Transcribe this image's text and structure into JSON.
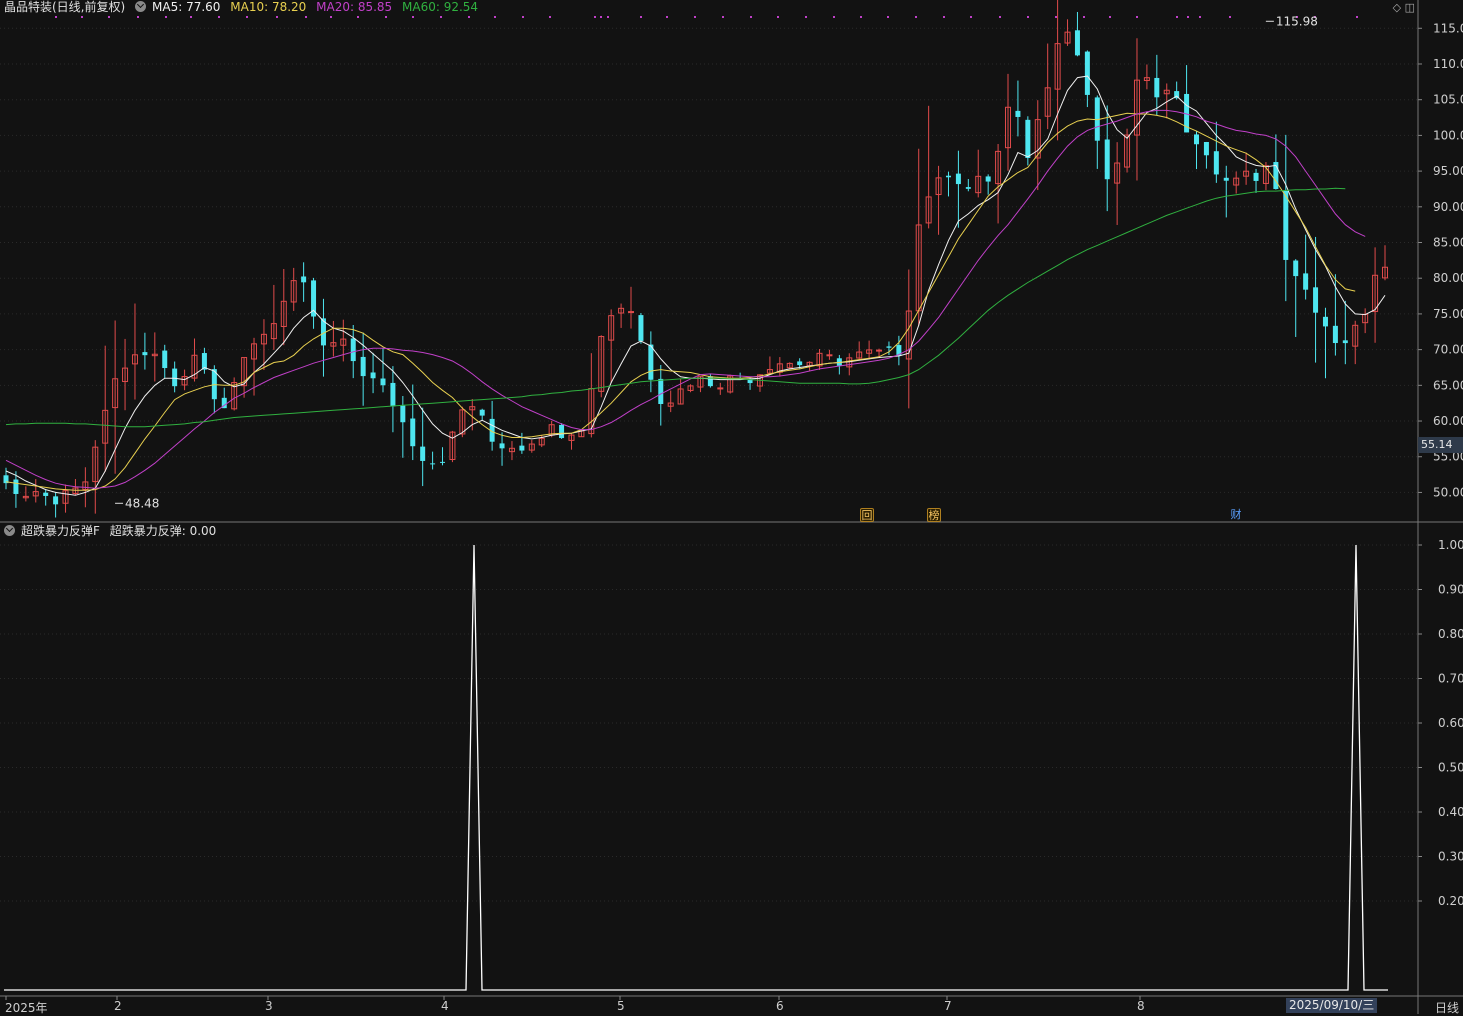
{
  "header": {
    "title": "晶品特装(日线,前复权)",
    "ma5": "MA5: 77.60",
    "ma10": "MA10: 78.20",
    "ma20": "MA20: 85.85",
    "ma60": "MA60: 92.54"
  },
  "indicator": {
    "name": "超跌暴力反弹F",
    "value_label": "超跌暴力反弹: 0.00"
  },
  "price_tag": "55.14",
  "markers": [
    {
      "label": "回",
      "style": "gold"
    },
    {
      "label": "榜",
      "style": "gold"
    },
    {
      "label": "财",
      "style": "blue"
    }
  ],
  "x_axis_labels": [
    "2025年",
    "2",
    "3",
    "4",
    "5",
    "6",
    "7",
    "8"
  ],
  "cursor_date": "2025/09/10/三",
  "period": "日线",
  "colors": {
    "background": "#121212",
    "up": "#e04b4b",
    "down": "#4ee6f0",
    "ma5": "#f0f0f0",
    "ma10": "#e8d050",
    "ma20": "#c040c8",
    "ma60": "#30b040",
    "indicator": "#ffffff"
  },
  "chart_data": [
    {
      "type": "candlestick",
      "title": "晶品特装(日线,前复权)",
      "ylim": [
        46,
        117
      ],
      "y_ticks": [
        "50.00",
        "55.00",
        "60.00",
        "65.00",
        "70.00",
        "75.00",
        "80.00",
        "85.00",
        "90.00",
        "95.00",
        "100.00",
        "105.00",
        "110.00",
        "115.00"
      ],
      "annotations": [
        "48.48",
        "115.98"
      ],
      "series": [
        {
          "name": "MA5",
          "values": [
            53,
            52.4,
            51.6,
            51,
            50.4,
            50,
            49.8,
            49.6,
            50,
            50.6,
            53,
            56,
            59,
            61.5,
            63.5,
            65,
            66,
            66,
            65.8,
            66.5,
            67.5,
            67,
            65.5,
            64.8,
            65.2,
            66.8,
            68,
            69.5,
            71,
            73,
            74.5,
            75.5,
            74,
            73,
            72.6,
            71.7,
            70.6,
            69.4,
            68.2,
            67,
            65.4,
            63.5,
            61.5,
            59.6,
            58.3,
            57.6,
            58.4,
            59.5,
            60.1,
            59.4,
            58.7,
            58.2,
            57.7,
            57.5,
            57.7,
            58,
            58.2,
            58.3,
            58.6,
            58.9,
            62,
            65.4,
            68,
            70.5,
            71.2,
            70.5,
            68.7,
            67.2,
            66.2,
            66,
            66,
            65.9,
            65.8,
            65.8,
            65.8,
            65.9,
            66,
            66.5,
            67,
            67.3,
            67.5,
            67.7,
            67.9,
            68.1,
            68.2,
            68.3,
            68.5,
            68.7,
            68.9,
            69,
            69.1,
            69.5,
            73.4,
            78.3,
            81.9,
            85.3,
            88,
            89,
            90.2,
            91,
            92,
            94.5,
            97.6,
            97,
            97.9,
            99.5,
            103,
            106.3,
            108.1,
            108.3,
            106.5,
            103.2,
            100.8,
            99.6,
            101.4,
            103.2,
            103.8,
            104.7,
            105.5,
            104.2,
            103.4,
            101.7,
            100,
            98.6,
            97,
            96.3,
            95.8,
            95.6,
            95.8,
            93.1,
            89.7,
            86.8,
            84,
            81.7,
            78.8,
            76.4,
            75,
            74.9,
            75.6,
            77.6
          ]
        },
        {
          "name": "MA10",
          "values": [
            51.5,
            51.3,
            51.1,
            50.9,
            50.7,
            50.5,
            50.4,
            50.3,
            50.3,
            50.4,
            50.9,
            51.9,
            53.5,
            55.5,
            57.5,
            59.3,
            61.2,
            63,
            63.8,
            64.3,
            64.8,
            65.1,
            65,
            65,
            65.5,
            66.8,
            67.5,
            68.2,
            68.4,
            69.2,
            70.5,
            71.5,
            72.3,
            73,
            73,
            72.8,
            72.3,
            71.3,
            70.4,
            69.7,
            69.3,
            68.1,
            66.8,
            65.4,
            64.3,
            63.3,
            61.8,
            60.6,
            59.5,
            58.5,
            58,
            57.7,
            57.7,
            57.8,
            58,
            58.2,
            58.3,
            58.3,
            58.8,
            59.9,
            61.2,
            62.5,
            64,
            65.5,
            66.4,
            67,
            67.2,
            67,
            66.9,
            66.8,
            66.5,
            66.2,
            66.1,
            66,
            66,
            66.1,
            66.3,
            66.6,
            66.9,
            67.1,
            67.3,
            67.6,
            67.9,
            68.1,
            68.2,
            68.4,
            68.6,
            68.8,
            69,
            69.7,
            71,
            73,
            75.5,
            78,
            80.5,
            83,
            85.5,
            87.5,
            89.5,
            91.5,
            92.8,
            93.8,
            94.8,
            95.5,
            97.3,
            99,
            100.3,
            101.3,
            102,
            102.3,
            102.2,
            102.5,
            102.8,
            103.1,
            103,
            103,
            102.8,
            102.5,
            101.9,
            101.2,
            100.6,
            99.9,
            99.2,
            98.5,
            98,
            97.5,
            96.6,
            95.5,
            93.6,
            91.5,
            89.3,
            87.1,
            84.4,
            81.8,
            79.8,
            78.5,
            78.2
          ]
        },
        {
          "name": "MA20",
          "values": [
            54.5,
            53.8,
            53.1,
            52.4,
            51.8,
            51.3,
            51,
            50.8,
            50.7,
            50.6,
            50.7,
            50.9,
            51.4,
            52.2,
            53.1,
            54.1,
            55.3,
            56.5,
            57.7,
            58.9,
            60,
            61.2,
            62.2,
            63.2,
            63.9,
            64.7,
            65.4,
            66.1,
            66.6,
            67.1,
            67.6,
            68.1,
            68.5,
            68.9,
            69.3,
            69.7,
            70,
            70.2,
            70.2,
            70.1,
            69.9,
            69.8,
            69.6,
            69.3,
            68.9,
            68.4,
            67.6,
            66.6,
            65.5,
            64.5,
            63.6,
            62.8,
            62,
            61.4,
            60.8,
            60.2,
            59.6,
            59.1,
            58.8,
            58.8,
            59.2,
            59.8,
            60.6,
            61.5,
            62.3,
            63,
            63.8,
            64.5,
            65.2,
            65.9,
            66.5,
            66.6,
            66.5,
            66.4,
            66.3,
            66.2,
            66.2,
            66.2,
            66.3,
            66.5,
            66.7,
            67,
            67.3,
            67.5,
            67.7,
            67.9,
            68.1,
            68.3,
            68.5,
            68.8,
            69.3,
            70,
            71.2,
            72.8,
            74.5,
            76.5,
            78.5,
            80.5,
            82.5,
            84.3,
            86,
            87.5,
            89.3,
            91.1,
            93,
            95,
            96.8,
            98.5,
            99.8,
            100.7,
            101.2,
            101.6,
            102,
            102.5,
            103,
            103.3,
            103.5,
            103.5,
            103.3,
            103,
            102.6,
            102,
            101.6,
            101.1,
            100.7,
            100.5,
            100.2,
            100,
            99.5,
            98.5,
            97,
            95,
            93,
            91,
            89,
            87.5,
            86.5,
            85.85
          ]
        },
        {
          "name": "MA60",
          "values": [
            59.5,
            59.6,
            59.6,
            59.7,
            59.7,
            59.7,
            59.7,
            59.6,
            59.6,
            59.5,
            59.4,
            59.3,
            59.2,
            59.2,
            59.2,
            59.3,
            59.4,
            59.5,
            59.6,
            59.8,
            59.9,
            60.1,
            60.3,
            60.5,
            60.6,
            60.7,
            60.8,
            60.9,
            61,
            61.1,
            61.2,
            61.3,
            61.4,
            61.5,
            61.6,
            61.7,
            61.8,
            61.9,
            62,
            62.1,
            62.2,
            62.3,
            62.4,
            62.5,
            62.6,
            62.7,
            62.8,
            62.9,
            63,
            63.1,
            63.2,
            63.3,
            63.4,
            63.6,
            63.7,
            63.9,
            64,
            64.2,
            64.3,
            64.5,
            64.7,
            64.9,
            65.1,
            65.3,
            65.5,
            65.6,
            65.7,
            65.8,
            65.9,
            66,
            66,
            66,
            66,
            65.9,
            65.9,
            65.8,
            65.7,
            65.6,
            65.5,
            65.4,
            65.3,
            65.3,
            65.3,
            65.3,
            65.3,
            65.2,
            65.2,
            65.3,
            65.5,
            65.8,
            66.1,
            66.5,
            67.2,
            68.2,
            69.2,
            70.4,
            71.6,
            72.9,
            74.2,
            75.5,
            76.6,
            77.6,
            78.5,
            79.4,
            80.2,
            81,
            81.8,
            82.6,
            83.3,
            84,
            84.6,
            85.2,
            85.8,
            86.4,
            87,
            87.6,
            88.2,
            88.8,
            89.3,
            89.8,
            90.3,
            90.8,
            91.2,
            91.5,
            91.7,
            91.9,
            92.1,
            92.2,
            92.2,
            92.3,
            92.4,
            92.4,
            92.5,
            92.5,
            92.6,
            92.54
          ]
        }
      ]
    },
    {
      "type": "line",
      "title": "超跌暴力反弹F",
      "ylim": [
        0,
        1.0
      ],
      "y_ticks": [
        "0.20",
        "0.30",
        "0.40",
        "0.50",
        "0.60",
        "0.70",
        "0.80",
        "0.90",
        "1.00"
      ],
      "series": [
        {
          "name": "超跌暴力反弹",
          "spikes_at_index": [
            57,
            165
          ],
          "spike_value": 1.0,
          "base_value": 0.0
        }
      ]
    }
  ]
}
